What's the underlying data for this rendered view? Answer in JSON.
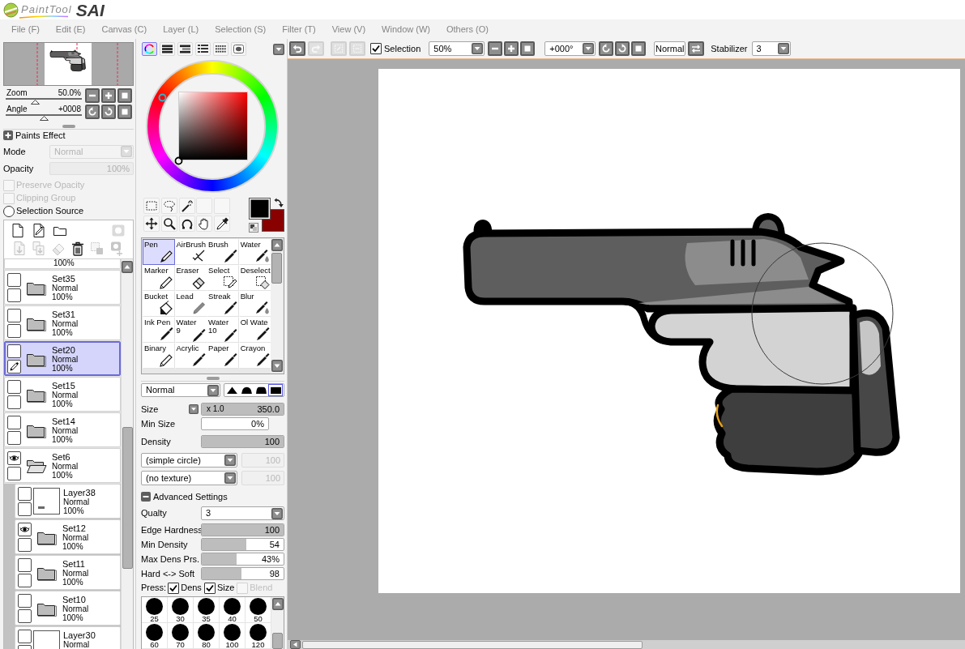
{
  "app": {
    "logo": {
      "name": "PaintTool",
      "mark": "SAI"
    }
  },
  "menu": [
    "File (F)",
    "Edit (E)",
    "Canvas (C)",
    "Layer (L)",
    "Selection (S)",
    "Filter (T)",
    "View (V)",
    "Window (W)",
    "Others (O)"
  ],
  "navigator": {
    "zoom": {
      "label": "Zoom",
      "value": "50.0%",
      "level": 0.38
    },
    "angle": {
      "label": "Angle",
      "value": "+0008",
      "level": 0.5
    }
  },
  "paints_effect": {
    "title": "Paints Effect",
    "mode": {
      "label": "Mode",
      "value": "Normal",
      "disabled": true
    },
    "opacity": {
      "label": "Opacity",
      "value": "100%",
      "disabled": true
    },
    "options": [
      {
        "kind": "checkbox",
        "label": "Preserve Opacity",
        "checked": false,
        "disabled": true
      },
      {
        "kind": "checkbox",
        "label": "Clipping Group",
        "checked": false,
        "disabled": true
      },
      {
        "kind": "radio",
        "label": "Selection Source",
        "checked": false,
        "disabled": false
      }
    ]
  },
  "layer_tools": [
    {
      "tools": [
        {
          "kind": "new-layer",
          "disabled": false
        },
        {
          "kind": "new-linework-layer",
          "disabled": false
        },
        {
          "kind": "new-folder",
          "disabled": false
        },
        {
          "kind": "new-mask",
          "disabled": true
        }
      ]
    },
    {
      "tools": [
        {
          "kind": "transfer-down",
          "disabled": true
        },
        {
          "kind": "merge-down",
          "disabled": true
        },
        {
          "kind": "clear",
          "disabled": true
        },
        {
          "kind": "delete",
          "disabled": false
        },
        {
          "kind": "apply-mask",
          "disabled": true
        },
        {
          "kind": "link-mask",
          "disabled": true
        }
      ]
    }
  ],
  "layers": [
    {
      "kind": "partial",
      "opacity": "100%",
      "selected": false
    },
    {
      "kind": "set",
      "name": "Set35",
      "blend": "Normal",
      "opacity": "100%",
      "visible": false,
      "editing": false,
      "selected": false,
      "expanded": false
    },
    {
      "kind": "set",
      "name": "Set31",
      "blend": "Normal",
      "opacity": "100%",
      "visible": false,
      "editing": false,
      "selected": false,
      "expanded": false
    },
    {
      "kind": "set",
      "name": "Set20",
      "blend": "Normal",
      "opacity": "100%",
      "visible": false,
      "editing": true,
      "selected": true,
      "expanded": false
    },
    {
      "kind": "set",
      "name": "Set15",
      "blend": "Normal",
      "opacity": "100%",
      "visible": false,
      "editing": false,
      "selected": false,
      "expanded": false
    },
    {
      "kind": "set",
      "name": "Set14",
      "blend": "Normal",
      "opacity": "100%",
      "visible": false,
      "editing": false,
      "selected": false,
      "expanded": false
    },
    {
      "kind": "set",
      "name": "Set6",
      "blend": "Normal",
      "opacity": "100%",
      "visible": true,
      "editing": false,
      "selected": false,
      "expanded": true,
      "children": [
        {
          "kind": "layer",
          "name": "Layer38",
          "blend": "Normal",
          "opacity": "100%",
          "visible": false,
          "editing": false,
          "selected": false
        },
        {
          "kind": "set",
          "name": "Set12",
          "blend": "Normal",
          "opacity": "100%",
          "visible": true,
          "editing": false,
          "selected": false,
          "expanded": false
        },
        {
          "kind": "set",
          "name": "Set11",
          "blend": "Normal",
          "opacity": "100%",
          "visible": false,
          "editing": false,
          "selected": false,
          "expanded": false
        },
        {
          "kind": "set",
          "name": "Set10",
          "blend": "Normal",
          "opacity": "100%",
          "visible": false,
          "editing": false,
          "selected": false,
          "expanded": false
        },
        {
          "kind": "layer",
          "name": "Layer30",
          "blend": "Normal",
          "visible": false,
          "editing": false,
          "selected": false
        }
      ]
    }
  ],
  "color_tabs": [
    {
      "kind": "wheel",
      "selected": true
    },
    {
      "kind": "rgb",
      "selected": false
    },
    {
      "kind": "hsv",
      "selected": false
    },
    {
      "kind": "swatches",
      "selected": false
    },
    {
      "kind": "scratchpad",
      "selected": false
    },
    {
      "kind": "mixer",
      "selected": false
    }
  ],
  "colors": [
    {
      "color": "#000000"
    },
    {
      "color": "#880000"
    }
  ],
  "brushes": [
    {
      "name": "Pen",
      "kind": "pen",
      "selected": true
    },
    {
      "name": "AirBrush",
      "kind": "airbrush",
      "selected": false
    },
    {
      "name": "Brush",
      "kind": "brush",
      "selected": false
    },
    {
      "name": "Water",
      "kind": "water",
      "selected": false
    },
    {
      "name": "Marker",
      "kind": "pencil",
      "selected": false
    },
    {
      "name": "Eraser",
      "kind": "eraser",
      "selected": false
    },
    {
      "name": "Select",
      "kind": "select",
      "selected": false
    },
    {
      "name": "Deselect",
      "kind": "deselect",
      "selected": false
    },
    {
      "name": "Bucket",
      "kind": "bucket",
      "selected": false
    },
    {
      "name": "Lead",
      "kind": "lead",
      "selected": false
    },
    {
      "name": "Streak",
      "kind": "brush",
      "selected": false
    },
    {
      "name": "Blur",
      "kind": "water",
      "selected": false
    },
    {
      "name": "Ink Pen",
      "kind": "brush",
      "selected": false
    },
    {
      "name": "Water\n9",
      "kind": "brush",
      "selected": false
    },
    {
      "name": "Water\n10",
      "kind": "brush",
      "selected": false
    },
    {
      "name": "Ol Wate",
      "kind": "brush",
      "selected": false
    },
    {
      "name": "Binary",
      "kind": "pencil",
      "selected": false
    },
    {
      "name": "Acrylic",
      "kind": "brush",
      "selected": false
    },
    {
      "name": "Paper",
      "kind": "brush",
      "selected": false
    },
    {
      "name": "Crayon",
      "kind": "brush",
      "selected": false
    }
  ],
  "brush_settings": {
    "blend": "Normal",
    "shapes": [
      {
        "kind": "peak",
        "selected": false
      },
      {
        "kind": "dome",
        "selected": false
      },
      {
        "kind": "mesa",
        "selected": false
      },
      {
        "kind": "square",
        "selected": true
      }
    ],
    "size": {
      "label": "Size",
      "multiplier": "x 1.0",
      "value": "350.0",
      "level": 1
    },
    "min_size": {
      "label": "Min Size",
      "value": "0%"
    },
    "density": {
      "label": "Density",
      "value": "100",
      "level": 1
    },
    "shape": {
      "value": "(simple circle)",
      "strength": "100"
    },
    "texture": {
      "value": "(no texture)",
      "strength": "100"
    },
    "advanced": {
      "title": "Advanced Settings",
      "expanded": true
    },
    "quality": {
      "label": "Qualty",
      "value": "3"
    },
    "sliders": [
      {
        "label": "Edge Hardness",
        "value": "100",
        "level": 1
      },
      {
        "label": "Min Density",
        "value": "54",
        "level": 0.54
      },
      {
        "label": "Max Dens Prs.",
        "value": "43%",
        "level": 0.43
      },
      {
        "label": "Hard <-> Soft",
        "value": "98",
        "level": 0.49
      }
    ],
    "pressure": {
      "label": "Press:",
      "options": [
        {
          "label": "Dens",
          "checked": true,
          "disabled": false
        },
        {
          "label": "Size",
          "checked": true,
          "disabled": false
        },
        {
          "label": "Blend",
          "checked": false,
          "disabled": true
        }
      ]
    },
    "presets": [
      "25",
      "30",
      "35",
      "40",
      "50",
      "60",
      "70",
      "80",
      "100",
      "120"
    ]
  },
  "toolbar": {
    "history": [
      {
        "kind": "undo",
        "disabled": false
      },
      {
        "kind": "redo",
        "disabled": true
      }
    ],
    "selection_tools": [
      {
        "kind": "crop",
        "disabled": true
      },
      {
        "kind": "clear-selection",
        "disabled": true
      }
    ],
    "selection_toggle": {
      "label": "Selection",
      "checked": true
    },
    "zoom": "50%",
    "angle": "+000°",
    "blend_mode": "Normal",
    "stabilizer": {
      "label": "Stabilizer",
      "value": "3"
    }
  }
}
